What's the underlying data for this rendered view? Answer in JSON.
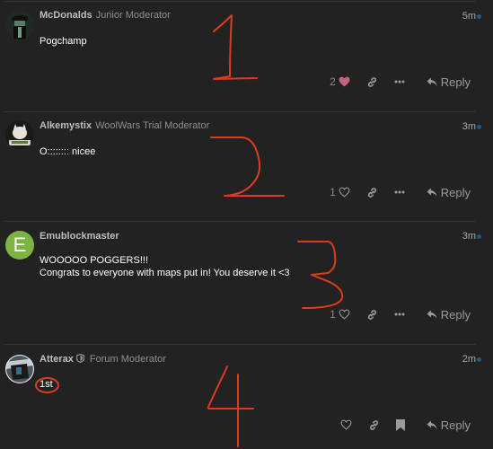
{
  "posts": [
    {
      "username": "McDonalds",
      "user_title": "Junior Moderator",
      "moderator_shield": false,
      "timestamp": "5m",
      "body_lines": [
        "Pogchamp"
      ],
      "likes": "2",
      "liked": true,
      "actions": [
        "like",
        "copy-link",
        "more",
        "reply"
      ],
      "reply_label": "Reply",
      "annotation": "1"
    },
    {
      "username": "Alkemystix",
      "user_title": "WoolWars Trial Moderator",
      "moderator_shield": false,
      "timestamp": "3m",
      "body_lines": [
        "O:::::::: nicee"
      ],
      "likes": "1",
      "liked": false,
      "actions": [
        "like",
        "copy-link",
        "more",
        "reply"
      ],
      "reply_label": "Reply",
      "annotation": "2"
    },
    {
      "username": "Emublockmaster",
      "user_title": "",
      "avatar_letter": "E",
      "avatar_color": "#7cb342",
      "moderator_shield": false,
      "timestamp": "3m",
      "body_lines": [
        "WOOOOO POGGERS!!!",
        "Congrats to everyone with maps put in! You deserve it <3"
      ],
      "likes": "1",
      "liked": false,
      "actions": [
        "like",
        "copy-link",
        "more",
        "reply"
      ],
      "reply_label": "Reply",
      "annotation": "3"
    },
    {
      "username": "Atterax",
      "user_title": "Forum Moderator",
      "moderator_shield": true,
      "timestamp": "2m",
      "body_lines": [
        "1st"
      ],
      "likes": "",
      "liked": false,
      "actions": [
        "like",
        "copy-link",
        "bookmark",
        "reply"
      ],
      "reply_label": "Reply",
      "annotation": "4"
    }
  ],
  "colors": {
    "background": "#222222",
    "liked_heart": "#c8607a",
    "annotation": "#e03a1e",
    "unread_dot": "#1f5a80"
  }
}
